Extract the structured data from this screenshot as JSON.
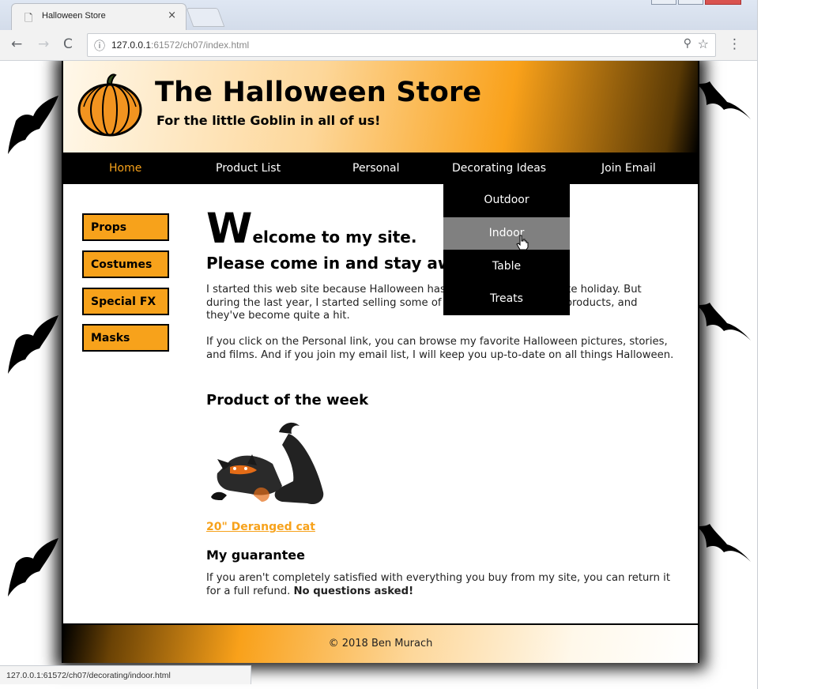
{
  "browser": {
    "tab_title": "Halloween Store",
    "tab_close": "×",
    "url_host": "127.0.0.1",
    "url_rest": ":61572/ch07/index.html",
    "status_url": "127.0.0.1:61572/ch07/decorating/indoor.html",
    "icons": [
      "page-icon",
      "back-icon",
      "forward-icon",
      "reload-icon",
      "info-icon",
      "zoom-icon",
      "star-icon",
      "menu-icon"
    ]
  },
  "site": {
    "title": "The Halloween Store",
    "tagline": "For the little Goblin in all of us!",
    "nav": [
      "Home",
      "Product List",
      "Personal",
      "Decorating Ideas",
      "Join Email"
    ],
    "current_nav": "Home",
    "dropdown": [
      "Outdoor",
      "Indoor",
      "Table",
      "Treats"
    ],
    "hovered_dropdown": "Indoor",
    "sidebar": [
      "Props",
      "Costumes",
      "Special FX",
      "Masks"
    ],
    "accent_color": "#f7a21b"
  },
  "main": {
    "dropcap": "W",
    "welcome_rest": "elcome to my site.",
    "heading2": "Please come in and stay awhile.",
    "para1": "I started this web site because Halloween has always been my favorite holiday. But during the last year, I started selling some of my favorite Halloween products, and they've become quite a hit.",
    "para2": "If you click on the Personal link, you can browse my favorite Halloween pictures, stories, and films. And if you join my email list, I will keep you up-to-date on all things Halloween.",
    "product_heading": "Product of the week",
    "product_link": "20\" Deranged cat",
    "guarantee_heading": "My guarantee",
    "guarantee_text": "If you aren't completely satisfied with everything you buy from my site, you can return it for a full refund.",
    "guarantee_bold": "No questions asked!"
  },
  "footer": {
    "copyright": "© 2018 Ben Murach"
  }
}
